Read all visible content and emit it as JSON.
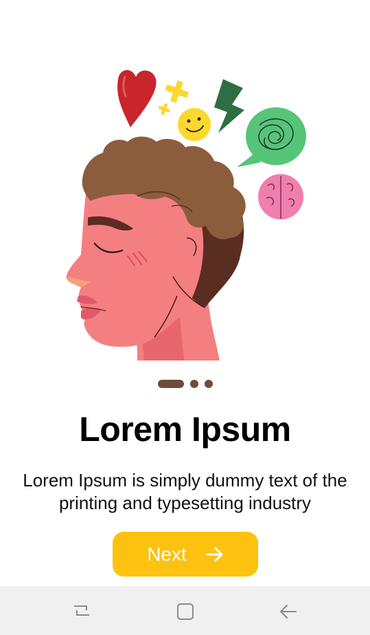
{
  "onboarding": {
    "title": "Lorem Ipsum",
    "description": "Lorem Ipsum is simply dummy text of the printing and typesetting industry",
    "next_label": "Next",
    "next_icon": "arrow-right-icon",
    "pagination": {
      "total": 3,
      "active_index": 0
    }
  },
  "illustration": {
    "name": "mental-health-head-illustration",
    "elements": [
      "heart-icon",
      "plus-sparkle-icon",
      "smiley-icon",
      "lightning-icon",
      "tangled-speech-bubble-icon",
      "brain-icon"
    ]
  },
  "navbar": {
    "buttons": [
      "recent-apps-icon",
      "home-icon",
      "back-icon"
    ]
  },
  "colors": {
    "accent": "#fdc20f",
    "dot": "#6f4a3c",
    "skin": "#f47f80",
    "hair": "#8c5d3d",
    "hair_dark": "#5a2d22",
    "heart": "#c9252c",
    "bolt": "#2e6e42",
    "bubble": "#56c479",
    "brain": "#ef7fac",
    "smiley": "#fbd82d",
    "navbar_bg": "#f0f0f0"
  }
}
